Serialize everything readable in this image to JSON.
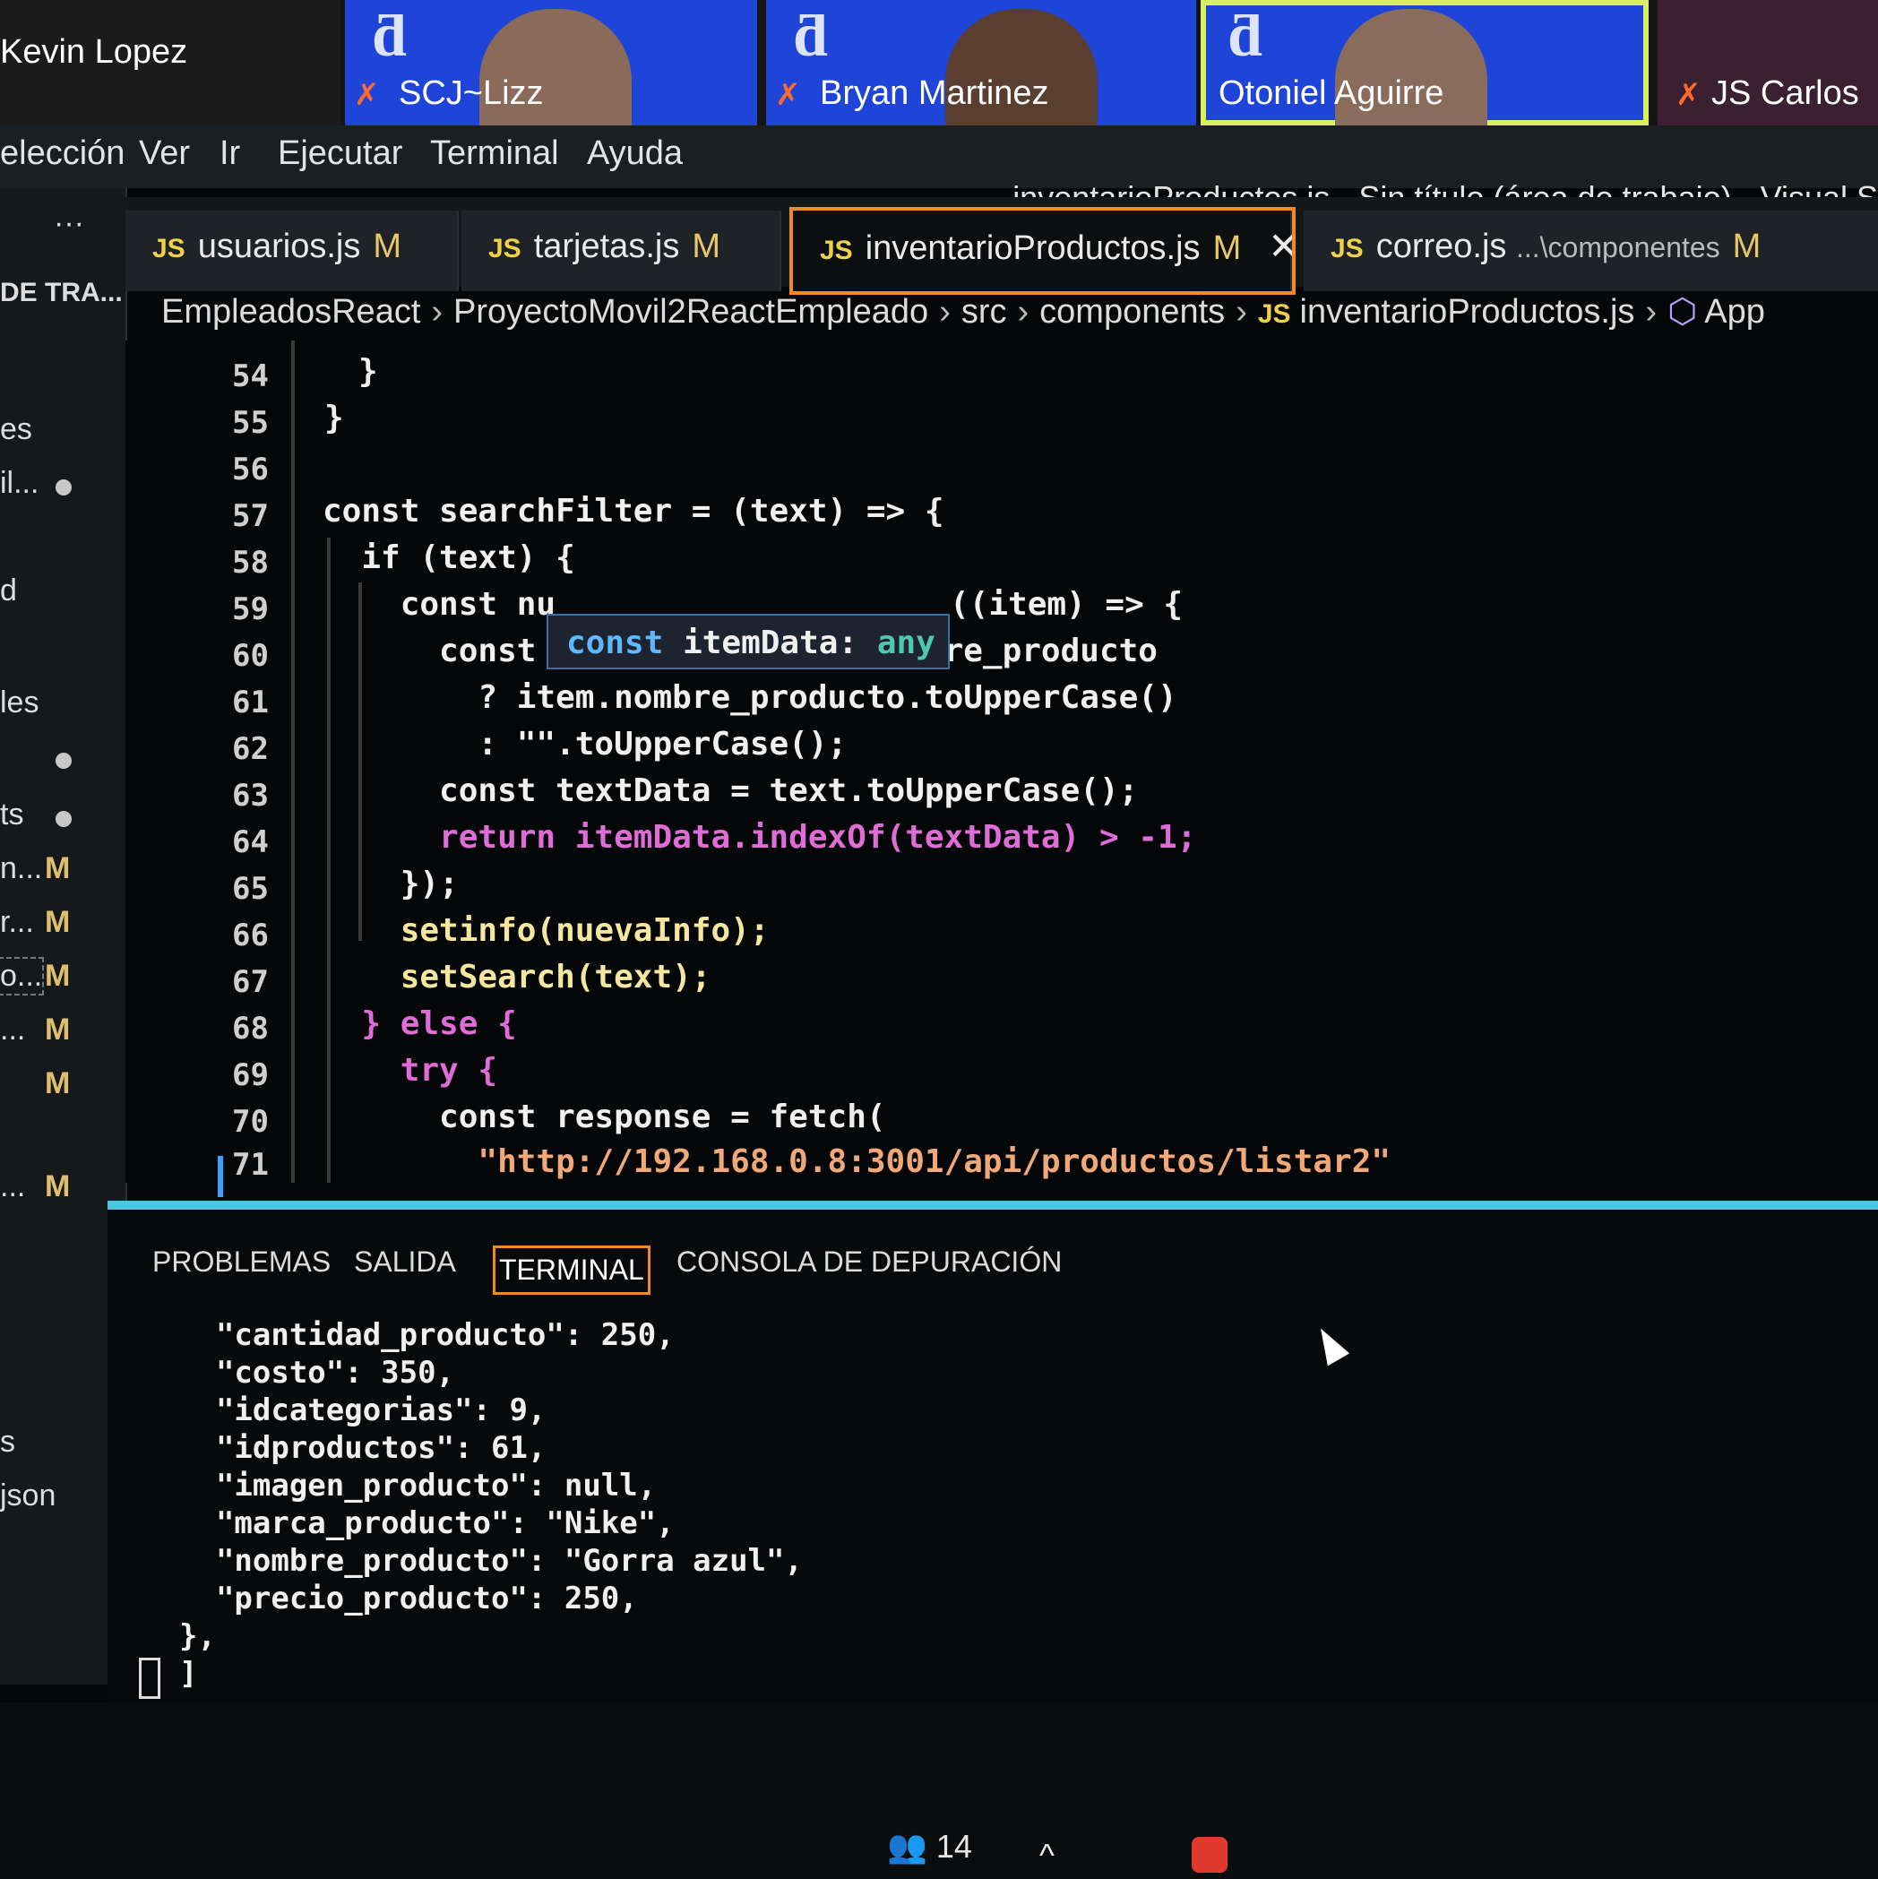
{
  "participants": [
    {
      "name": "Kevin Lopez"
    },
    {
      "name": "SCJ~Lizz"
    },
    {
      "name": "Bryan Martinez"
    },
    {
      "name": "Otoniel Aguirre"
    },
    {
      "name": "JS Carlos"
    }
  ],
  "menu": [
    "elección",
    "Ver",
    "Ir",
    "Ejecutar",
    "Terminal",
    "Ayuda"
  ],
  "window_title": "inventarioProductos.js - Sin título (área de trabajo) - Visual S",
  "sidebar": {
    "more": "···",
    "header": "DE TRA...",
    "items": [
      {
        "label": "es"
      },
      {
        "label": "il..."
      },
      {
        "label": "d"
      },
      {
        "label": "les"
      },
      {
        "label": "ts"
      },
      {
        "label": "n..."
      },
      {
        "label": "r..."
      },
      {
        "label": "o..."
      },
      {
        "label": "..."
      },
      {
        "label": "..."
      },
      {
        "label": "s"
      },
      {
        "label": "json"
      }
    ],
    "badge": "M"
  },
  "tabs": [
    {
      "icon": "JS",
      "label": "usuarios.js",
      "status": "M"
    },
    {
      "icon": "JS",
      "label": "tarjetas.js",
      "status": "M"
    },
    {
      "icon": "JS",
      "label": "inventarioProductos.js",
      "status": "M",
      "close": "✕"
    },
    {
      "icon": "JS",
      "label": "correo.js",
      "path": "...\\componentes",
      "status": "M"
    }
  ],
  "breadcrumb": [
    "EmpleadosReact",
    "ProyectoMovil2ReactEmpleado",
    "src",
    "components",
    "inventarioProductos.js",
    "App"
  ],
  "editor": {
    "line_numbers": [
      "54",
      "55",
      "56",
      "57",
      "58",
      "59",
      "60",
      "61",
      "62",
      "63",
      "64",
      "65",
      "66",
      "67",
      "68",
      "69",
      "70",
      "71"
    ],
    "lines": [
      "}",
      "}",
      "",
      "const searchFilter = (text) => {",
      "  if (text) {",
      "    const nu",
      "      const itemData = item.nombre_producto",
      "        ? item.nombre_producto.toUpperCase()",
      "        : \"\".toUpperCase();",
      "      const textData = text.toUpperCase();",
      "      return itemData.indexOf(textData) > -1;",
      "    });",
      "    setinfo(nuevaInfo);",
      "    setSearch(text);",
      "  } else {",
      "    try {",
      "      const response = fetch(",
      "        \"http://192.168.0.8:3001/api/productos/listar2\""
    ],
    "line60_tail": "((item) => {",
    "tooltip": {
      "kw": "const",
      "name": "itemData:",
      "type": "any"
    }
  },
  "panel": {
    "tabs": [
      "PROBLEMAS",
      "SALIDA",
      "TERMINAL",
      "CONSOLA DE DEPURACIÓN"
    ],
    "active_tab": "TERMINAL",
    "terminal_lines": [
      "  \"cantidad_producto\": 250,",
      "  \"costo\": 350,",
      "  \"idcategorias\": 9,",
      "  \"idproductos\": 61,",
      "  \"imagen_producto\": null,",
      "  \"marca_producto\": \"Nike\",",
      "  \"nombre_producto\": \"Gorra azul\",",
      "  \"precio_producto\": 250,",
      "},",
      "]"
    ]
  },
  "taskbar": {
    "people_count": "14",
    "chevron": "^"
  },
  "colors": {
    "accent": "#f08a22",
    "panel_border": "#4fc3e0",
    "keyword": "#5fb7ff",
    "control": "#e06cd8"
  }
}
